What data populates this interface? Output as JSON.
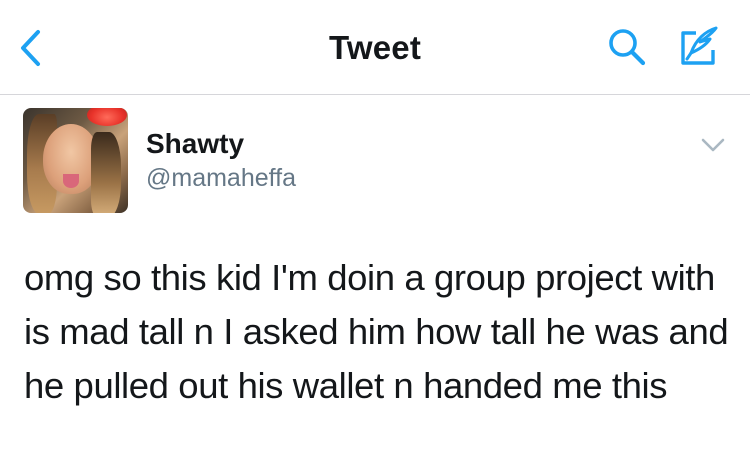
{
  "nav": {
    "title": "Tweet",
    "accent_color": "#1da1f2",
    "icons": {
      "back": "chevron-left-icon",
      "search": "search-icon",
      "compose": "compose-icon"
    }
  },
  "tweet": {
    "author": {
      "display_name": "Shawty",
      "username": "@mamaheffa"
    },
    "more_icon": "chevron-down-icon",
    "text": "omg so this kid I'm doin a group project with is mad tall n I asked him how tall he was and he pulled out his wallet n handed me this"
  }
}
